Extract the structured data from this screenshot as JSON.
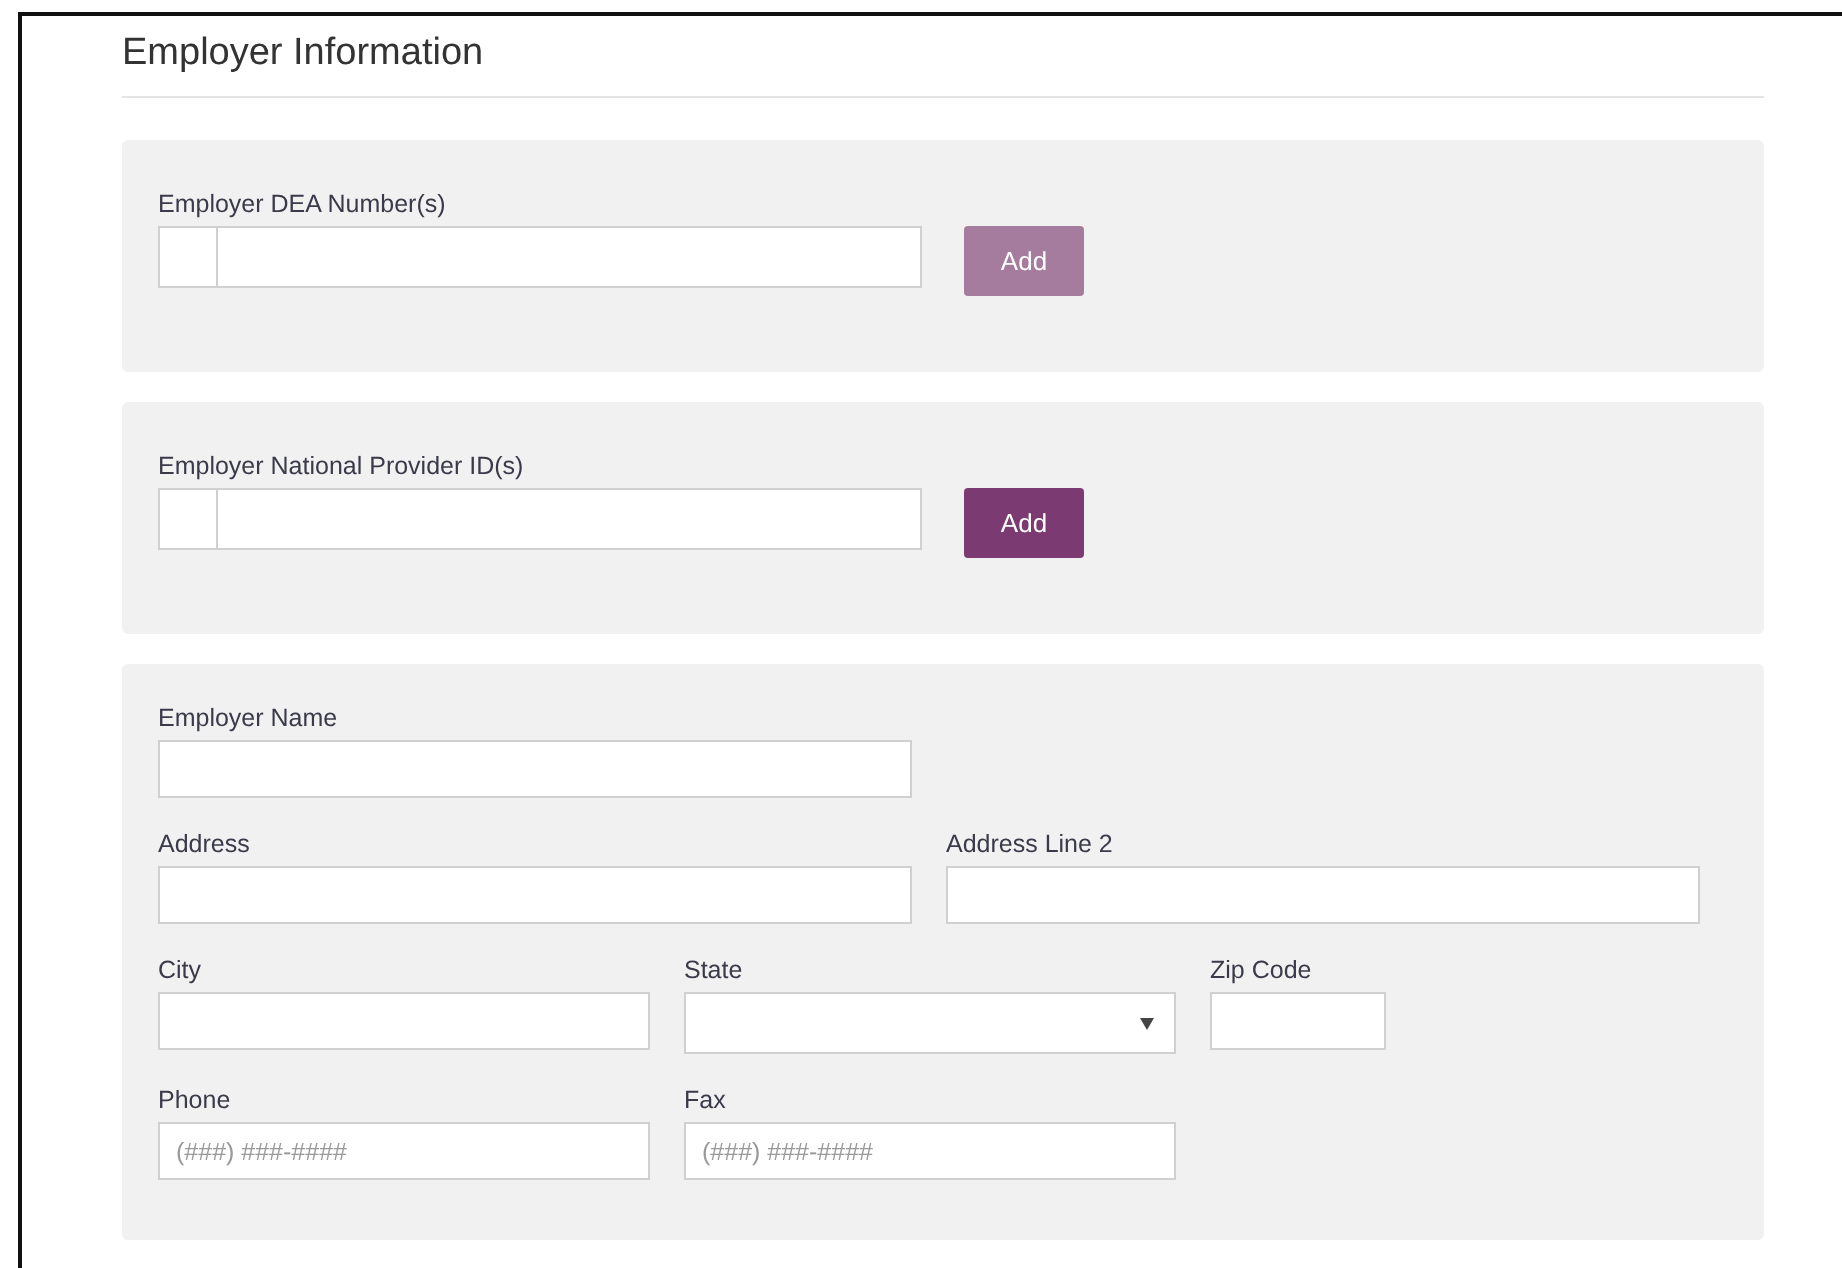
{
  "heading": "Employer Information",
  "id_groups": [
    {
      "label": "Employer DEA Number(s)",
      "button": "Add",
      "disabled": true
    },
    {
      "label": "Employer National Provider ID(s)",
      "button": "Add",
      "disabled": false
    }
  ],
  "employer_form": {
    "rows": [
      [
        {
          "label": "Employer Name",
          "kind": "text"
        }
      ],
      [
        {
          "label": "Address",
          "kind": "text"
        },
        {
          "label": "Address Line 2",
          "kind": "text"
        }
      ],
      [
        {
          "label": "City",
          "kind": "text"
        },
        {
          "label": "State",
          "kind": "select"
        },
        {
          "label": "Zip Code",
          "kind": "text"
        }
      ],
      [
        {
          "label": "Phone",
          "kind": "text",
          "placeholder": "(###) ###-####"
        },
        {
          "label": "Fax",
          "kind": "text",
          "placeholder": "(###) ###-####"
        }
      ]
    ]
  }
}
